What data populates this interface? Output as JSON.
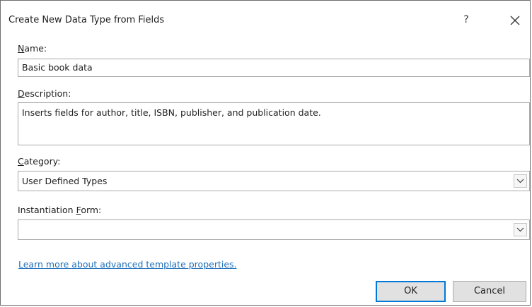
{
  "window": {
    "title": "Create New Data Type from Fields",
    "help_label": "?"
  },
  "name_field": {
    "label_accel": "N",
    "label_rest": "ame:",
    "value": "Basic book data"
  },
  "description_field": {
    "label_accel": "D",
    "label_rest": "escription:",
    "value": "Inserts fields for author, title, ISBN, publisher, and publication date."
  },
  "category_field": {
    "label_accel": "C",
    "label_rest": "ategory:",
    "selected": "User Defined Types"
  },
  "instantiation_field": {
    "label_before": "Instantiation ",
    "label_accel": "F",
    "label_rest": "orm:",
    "selected": ""
  },
  "learn_more_link": "Learn more about advanced template properties.",
  "buttons": {
    "ok": "OK",
    "cancel": "Cancel"
  },
  "icons": {
    "close": "close-icon",
    "dropdown": "chevron-down-icon"
  }
}
